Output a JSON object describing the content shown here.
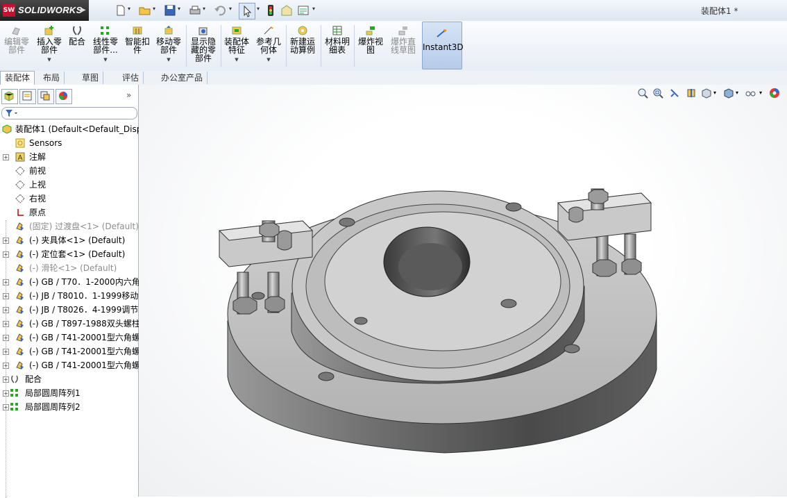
{
  "app": {
    "logo_text": "SOLIDWORKS",
    "logo_badge": "SW",
    "document_title": "装配体1 *"
  },
  "quick_access": [
    "new-document-icon",
    "open-folder-icon",
    "save-icon",
    "print-icon",
    "undo-icon",
    "select-pointer-icon",
    "traffic-light-icon",
    "file-properties-icon",
    "options-icon"
  ],
  "ribbon": {
    "buttons": [
      {
        "label": "编辑零\n部件",
        "disabled": true
      },
      {
        "label": "插入零\n部件",
        "dropdown": true
      },
      {
        "label": "配合"
      },
      {
        "label": "线性零\n部件...",
        "dropdown": true
      },
      {
        "label": "智能扣\n件"
      },
      {
        "label": "移动零\n部件",
        "dropdown": true
      },
      {
        "label": "显示隐\n藏的零\n部件"
      },
      {
        "label": "装配体\n特征",
        "dropdown": true
      },
      {
        "label": "参考几\n何体",
        "dropdown": true
      },
      {
        "label": "新建运\n动算例"
      },
      {
        "label": "材料明\n细表"
      },
      {
        "label": "爆炸视\n图"
      },
      {
        "label": "爆炸直\n线草图",
        "disabled": true
      },
      {
        "label": "Instant3D",
        "active": true
      }
    ]
  },
  "tabs": [
    "装配体",
    "布局",
    "草图",
    "评估",
    "办公室产品"
  ],
  "feature_tree": {
    "root": "装配体1  (Default<Default_Disp",
    "items": [
      {
        "label": "Sensors",
        "icon": "sensors-icon",
        "expand": false
      },
      {
        "label": "注解",
        "icon": "annotation-icon",
        "expand": true
      },
      {
        "label": "前视",
        "icon": "plane-icon",
        "expand": false
      },
      {
        "label": "上视",
        "icon": "plane-icon",
        "expand": false
      },
      {
        "label": "右视",
        "icon": "plane-icon",
        "expand": false
      },
      {
        "label": "原点",
        "icon": "origin-icon",
        "expand": false
      },
      {
        "label": "(固定) 过渡盘<1> (Default)",
        "icon": "part-icon",
        "expand": false,
        "dim": true
      },
      {
        "label": "(-) 夹具体<1> (Default)",
        "icon": "part-icon",
        "expand": true
      },
      {
        "label": "(-) 定位套<1> (Default)",
        "icon": "part-icon",
        "expand": true
      },
      {
        "label": "(-) 滑轮<1> (Default)",
        "icon": "part-icon",
        "expand": false,
        "dim": true
      },
      {
        "label": "(-) GB / T70．1-2000内六角",
        "icon": "part-icon",
        "expand": true
      },
      {
        "label": "(-) JB / T8010．1-1999移动",
        "icon": "part-icon",
        "expand": true
      },
      {
        "label": "(-) JB / T8026．4-1999调节",
        "icon": "part-icon",
        "expand": true
      },
      {
        "label": "(-) GB / T897-1988双头螺柱",
        "icon": "part-icon",
        "expand": true
      },
      {
        "label": "(-) GB / T41-20001型六角螺",
        "icon": "part-icon",
        "expand": true
      },
      {
        "label": "(-) GB / T41-20001型六角螺",
        "icon": "part-icon",
        "expand": true
      },
      {
        "label": "(-) GB / T41-20001型六角螺",
        "icon": "part-icon",
        "expand": true
      },
      {
        "label": "配合",
        "icon": "mates-icon",
        "expand": true,
        "short": true
      },
      {
        "label": "局部圆周阵列1",
        "icon": "pattern-icon",
        "expand": true,
        "short": true
      },
      {
        "label": "局部圆周阵列2",
        "icon": "pattern-icon",
        "expand": true,
        "short": true
      }
    ]
  },
  "panel_tabs": [
    "feature-manager-icon",
    "property-manager-icon",
    "configuration-manager-icon",
    "display-manager-icon"
  ],
  "view_tools": [
    "zoom-to-fit-icon",
    "zoom-area-icon",
    "previous-view-icon",
    "section-view-icon",
    "view-orientation-icon",
    "display-style-icon",
    "hide-show-items-icon",
    "appearance-icon"
  ]
}
